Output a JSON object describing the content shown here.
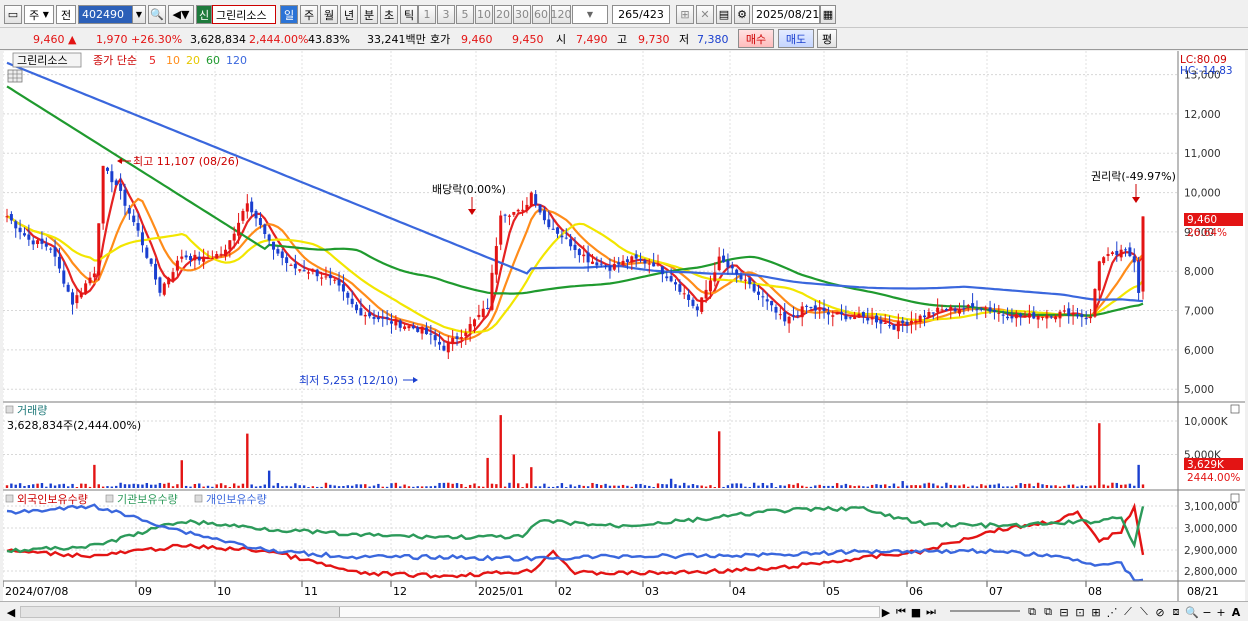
{
  "toolbar": {
    "market": "주",
    "scope": "전",
    "code": "402490",
    "new_badge": "신",
    "stock_name": "그린리소스",
    "periods": [
      "일",
      "주",
      "월",
      "년",
      "분",
      "초",
      "틱"
    ],
    "active_period": "일",
    "intervals": [
      "1",
      "3",
      "5",
      "10",
      "20",
      "30",
      "60",
      "120"
    ],
    "page_current": "265",
    "page_total": "423",
    "date": "2025/08/21"
  },
  "quote": {
    "price": "9,460",
    "change": "1,970",
    "change_pct": "+26.30%",
    "volume": "3,628,834",
    "volume_pct": "2,444.00%",
    "turnover": "43.83%",
    "amount": "33,241백만",
    "ask_label": "호가",
    "ask1": "9,460",
    "ask2": "9,450",
    "open_label": "시",
    "open": "7,490",
    "high_label": "고",
    "high": "9,730",
    "low_label": "저",
    "low": "7,380",
    "buy": "매수",
    "sell": "매도",
    "eval": "평"
  },
  "legend": {
    "name": "그린리소스",
    "ma_label": "종가 단순",
    "ma_periods": [
      "5",
      "10",
      "20",
      "60",
      "120"
    ],
    "ma_colors": [
      "#e52222",
      "#ff8c1a",
      "#f2e600",
      "#1f9a2e",
      "#3a67dd"
    ],
    "lc": "LC:80.09",
    "hc": "HC:-14.83"
  },
  "colors": {
    "up": "#e31414",
    "down": "#1a3fcf",
    "foreign": "#e31414",
    "inst": "#2c9a5a",
    "indiv": "#3a67dd"
  },
  "chart_data": {
    "type": "candlestick",
    "y_ticks": [
      "13,000",
      "12,000",
      "11,000",
      "10,000",
      "9,000",
      "8,000",
      "7,000",
      "6,000",
      "5,000"
    ],
    "y_range": [
      4700,
      13600
    ],
    "x_labels": [
      "2024/07/08",
      "09",
      "10",
      "11",
      "12",
      "2025/01",
      "02",
      "03",
      "04",
      "05",
      "06",
      "07",
      "08"
    ],
    "annotations": {
      "high": "최고 11,107 (08/26)",
      "low": "최저 5,253 (12/10)",
      "dividend": "배당락(0.00%)",
      "rights": "권리락(-49.97%)"
    },
    "price_tag": "9,460",
    "price_tag_pct": "26.64%",
    "close_anchors": [
      [
        0,
        9400
      ],
      [
        5,
        8800
      ],
      [
        10,
        8600
      ],
      [
        15,
        7200
      ],
      [
        20,
        8000
      ],
      [
        22,
        10600
      ],
      [
        25,
        10200
      ],
      [
        30,
        9000
      ],
      [
        35,
        7500
      ],
      [
        40,
        8400
      ],
      [
        45,
        8300
      ],
      [
        50,
        8500
      ],
      [
        55,
        9800
      ],
      [
        60,
        8700
      ],
      [
        65,
        8100
      ],
      [
        70,
        8000
      ],
      [
        75,
        7700
      ],
      [
        80,
        7000
      ],
      [
        85,
        6800
      ],
      [
        90,
        6650
      ],
      [
        95,
        6500
      ],
      [
        100,
        6050
      ],
      [
        105,
        6500
      ],
      [
        110,
        7100
      ],
      [
        113,
        9500
      ],
      [
        118,
        9500
      ],
      [
        120,
        10000
      ],
      [
        123,
        9300
      ],
      [
        128,
        8800
      ],
      [
        133,
        8300
      ],
      [
        138,
        8100
      ],
      [
        143,
        8300
      ],
      [
        148,
        8200
      ],
      [
        153,
        7700
      ],
      [
        158,
        7000
      ],
      [
        163,
        8300
      ],
      [
        168,
        7800
      ],
      [
        173,
        7300
      ],
      [
        178,
        6700
      ],
      [
        183,
        7100
      ],
      [
        188,
        6900
      ],
      [
        193,
        6850
      ],
      [
        198,
        6800
      ],
      [
        203,
        6600
      ],
      [
        208,
        6800
      ],
      [
        213,
        7000
      ],
      [
        218,
        7050
      ],
      [
        223,
        7100
      ],
      [
        228,
        6900
      ],
      [
        233,
        6850
      ],
      [
        238,
        6900
      ],
      [
        243,
        6950
      ],
      [
        248,
        6800
      ],
      [
        250,
        8300
      ],
      [
        253,
        8400
      ],
      [
        256,
        8500
      ],
      [
        258,
        8300
      ],
      [
        259,
        7500
      ],
      [
        260,
        9460
      ]
    ],
    "volume": {
      "label": "거래량",
      "value_text": "3,628,834주(2,444.00%)",
      "y_ticks": [
        "10,000K",
        "5,000K"
      ],
      "tag": "3,629K",
      "tag_pct": "2444.00%",
      "spikes": [
        [
          20,
          2000
        ],
        [
          40,
          2400
        ],
        [
          55,
          4700
        ],
        [
          60,
          1500
        ],
        [
          110,
          2600
        ],
        [
          113,
          6300
        ],
        [
          116,
          2900
        ],
        [
          120,
          1800
        ],
        [
          152,
          800
        ],
        [
          163,
          4900
        ],
        [
          205,
          600
        ],
        [
          250,
          5600
        ],
        [
          259,
          2000
        ]
      ]
    },
    "holdings": {
      "series": [
        "외국인보유수량",
        "기관보유수량",
        "개인보유수량"
      ],
      "y_ticks": [
        "3,100,000",
        "3,000,000",
        "2,900,000",
        "2,800,000"
      ]
    }
  }
}
